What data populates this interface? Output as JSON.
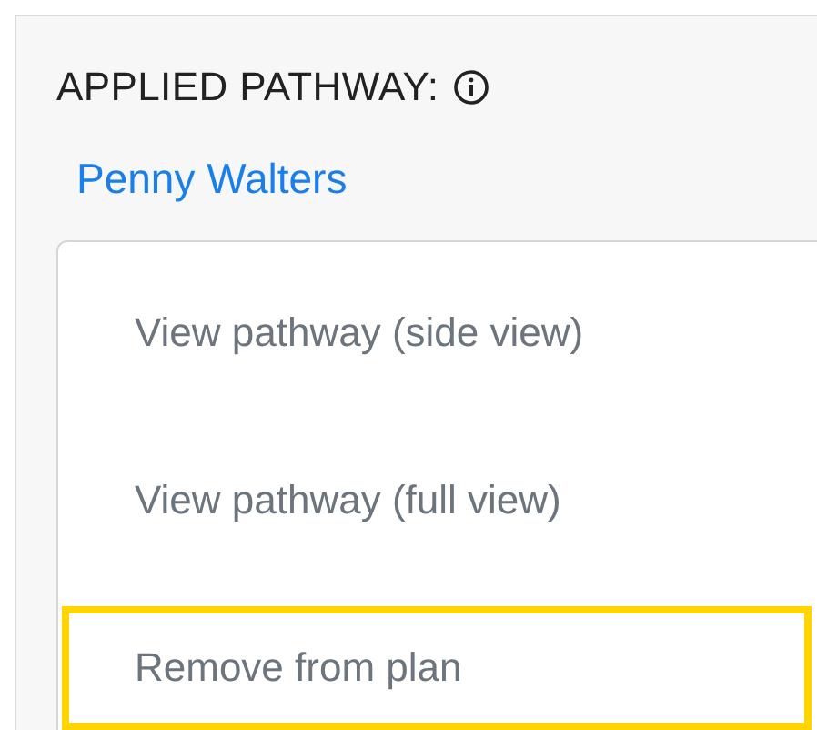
{
  "heading": {
    "label": "APPLIED PATHWAY:"
  },
  "pathway_owner": "Penny Walters",
  "menu": {
    "items": [
      {
        "label": "View pathway (side view)",
        "highlighted": false
      },
      {
        "label": "View pathway (full view)",
        "highlighted": false
      },
      {
        "label": "Remove from plan",
        "highlighted": true
      }
    ]
  }
}
